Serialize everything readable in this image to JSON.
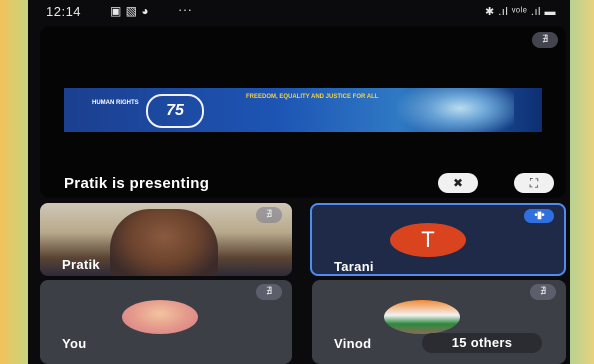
{
  "status_bar": {
    "time": "12:14",
    "notification_icons": "▣ ▧ ◕",
    "more": "···",
    "system_icons": "✱ .ıl ᵛᵒˡᵉ .ıl ▬"
  },
  "presentation": {
    "caption": "Pratik is presenting",
    "banner": {
      "org_text": "HUMAN RIGHTS",
      "number": "75",
      "slogan": "FREEDOM, EQUALITY AND JUSTICE FOR ALL"
    },
    "mic_off_icon": "∄",
    "unpin_icon": "✖",
    "fullscreen_icon": "⛶"
  },
  "participants": [
    {
      "name": "Pratik",
      "mic_icon": "∄"
    },
    {
      "name": "Tarani",
      "initial": "T",
      "speaking_icon": "•▮•"
    },
    {
      "name": "You",
      "mic_icon": "∄"
    },
    {
      "name": "Vinod",
      "mic_icon": "∄",
      "others_label": "15 others"
    }
  ],
  "colors": {
    "accent": "#4d8cf0",
    "avatar_t": "#d9441f"
  }
}
